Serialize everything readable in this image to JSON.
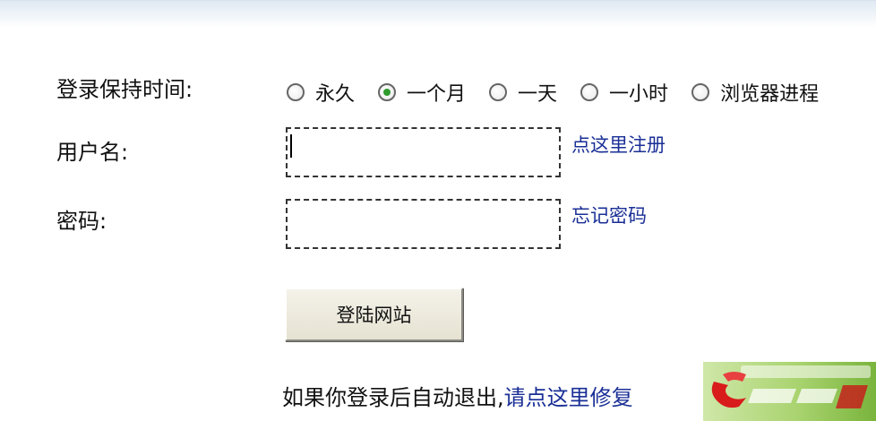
{
  "login": {
    "keep_label": "登录保持时间:",
    "keep_options": [
      {
        "label": "永久",
        "checked": false
      },
      {
        "label": "一个月",
        "checked": true
      },
      {
        "label": "一天",
        "checked": false
      },
      {
        "label": "一小时",
        "checked": false
      },
      {
        "label": "浏览器进程",
        "checked": false
      }
    ],
    "username_label": "用户名:",
    "username_value": "",
    "register_link": "点这里注册",
    "password_label": "密码:",
    "password_value": "",
    "forgot_link": "忘记密码",
    "submit_label": "登陆网站",
    "footer_text": "如果你登录后自动退出,",
    "footer_link": "请点这里修复"
  },
  "colors": {
    "link": "#1a2f96",
    "radio_checked": "#2e9a2e",
    "button_face": "#ece9d8"
  },
  "watermark": {
    "logo": "sonpack-logo"
  }
}
